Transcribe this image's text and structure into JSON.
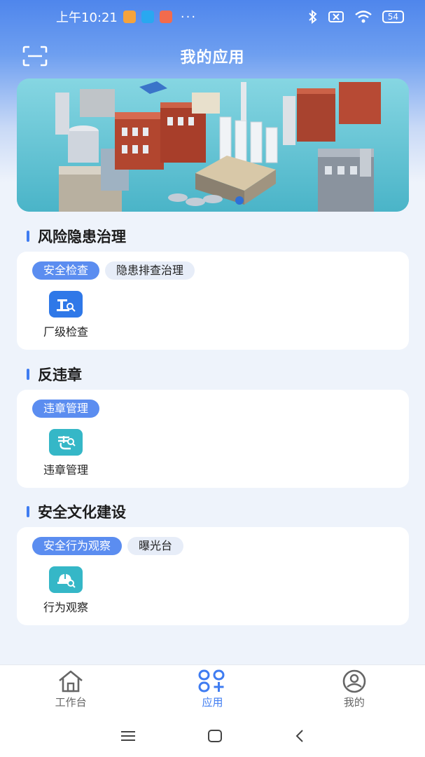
{
  "status_bar": {
    "time": "上午10:21",
    "more": "···",
    "battery": "54"
  },
  "header": {
    "title": "我的应用"
  },
  "sections": [
    {
      "title": "风险隐患治理",
      "tabs": [
        "安全检查",
        "隐患排查治理"
      ],
      "active_tab": 0,
      "apps": [
        {
          "label": "厂级检查",
          "icon": "factory-inspection-icon",
          "color": "#2f78e8"
        }
      ]
    },
    {
      "title": "反违章",
      "tabs": [
        "违章管理"
      ],
      "active_tab": 0,
      "apps": [
        {
          "label": "违章管理",
          "icon": "violation-management-icon",
          "color": "#35b7c7"
        }
      ]
    },
    {
      "title": "安全文化建设",
      "tabs": [
        "安全行为观察",
        "曝光台"
      ],
      "active_tab": 0,
      "apps": [
        {
          "label": "行为观察",
          "icon": "behavior-observation-icon",
          "color": "#35b7c7"
        }
      ]
    }
  ],
  "bottom_nav": {
    "items": [
      {
        "label": "工作台",
        "icon": "home-icon"
      },
      {
        "label": "应用",
        "icon": "apps-icon"
      },
      {
        "label": "我的",
        "icon": "profile-icon"
      }
    ],
    "active_index": 1
  },
  "colors": {
    "accent": "#3f7cf1",
    "active_tab": "#5b8df0",
    "inactive_tab": "#e7edf8",
    "header_gradient_top": "#4f86ec"
  }
}
